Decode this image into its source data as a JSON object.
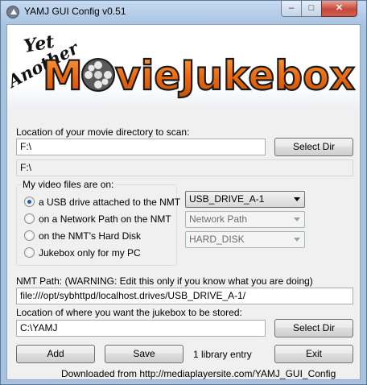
{
  "window": {
    "title": "YAMJ GUI Config v0.51",
    "minimize_glyph": "–",
    "maximize_glyph": "□",
    "close_glyph": "✕",
    "icon": "app-icon"
  },
  "banner": {
    "line1": "Yet",
    "line2": "Another",
    "main_part1": "M",
    "main_part2": "vieJukebox"
  },
  "movie_dir": {
    "label": "Location of your movie directory to scan:",
    "value": "F:\\",
    "select_button": "Select Dir",
    "echo": "F:\\"
  },
  "video_files": {
    "group_title": "My video files are on:",
    "options": [
      {
        "label": "a USB drive attached to the NMT",
        "checked": true
      },
      {
        "label": "on a Network Path on the NMT",
        "checked": false
      },
      {
        "label": "on the NMT's Hard Disk",
        "checked": false
      },
      {
        "label": "Jukebox only for my PC",
        "checked": false
      }
    ],
    "usb_combo": "USB_DRIVE_A-1",
    "network_combo": "Network Path",
    "hdd_combo": "HARD_DISK"
  },
  "nmt_path": {
    "label": "NMT Path:  (WARNING: Edit this only if you know what you are doing)",
    "value": "file:///opt/sybhttpd/localhost.drives/USB_DRIVE_A-1/"
  },
  "jukebox": {
    "label": "Location of where you want the jukebox to be stored:",
    "value": "C:\\YAMJ",
    "select_button": "Select Dir"
  },
  "actions": {
    "add": "Add",
    "save": "Save",
    "status": "1 library entry",
    "exit": "Exit"
  },
  "footer": "Downloaded from http://mediaplayersite.com/YAMJ_GUI_Config",
  "colors": {
    "banner_orange": "#f07a1a",
    "banner_outline": "#1a1a1a"
  }
}
